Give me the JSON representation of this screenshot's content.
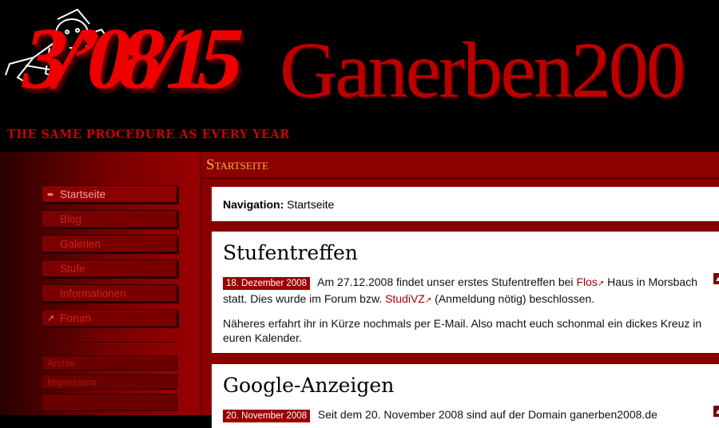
{
  "header": {
    "date_logo": "3/’08/15",
    "slogan": "THE SAME PROCEDURE AS EVERY YEAR",
    "site_title": "Ganerben200"
  },
  "sidebar": {
    "items": [
      {
        "label": "Startseite",
        "icon": "arrow-right-icon",
        "active": true
      },
      {
        "label": "Blog"
      },
      {
        "label": "Galerien"
      },
      {
        "label": "Stufe"
      },
      {
        "label": "Informationen"
      },
      {
        "label": "Forum",
        "icon": "external-link-icon"
      }
    ],
    "secondary": [
      {
        "label": "Archiv"
      },
      {
        "label": "Impressum"
      }
    ]
  },
  "section": {
    "title": "Startseite"
  },
  "navigation": {
    "label": "Navigation:",
    "value": "Startseite"
  },
  "posts": [
    {
      "title": "Stufentreffen",
      "date": "18. Dezember 2008",
      "p1_before": "Am 27.12.2008 findet unser erstes Stufentreffen bei",
      "link1": "Flos",
      "p1_mid": "Haus in Morsbach statt. Dies wurde im Forum bzw.",
      "link2": "StudiVZ",
      "p1_after": "(Anmeldung nötig) beschlossen.",
      "p2": "Näheres erfahrt ihr in Kürze nochmals per E-Mail. Also macht euch schonmal ein dickes Kreuz in euren Kalender."
    },
    {
      "title": "Google-Anzeigen",
      "date": "20. November 2008",
      "p1_before": "Seit dem 20. November 2008 sind auf der Domain ganerben2008.de"
    }
  ],
  "colors": {
    "accent": "#9a0000",
    "section_title": "#ffb040",
    "background": "#000000"
  }
}
